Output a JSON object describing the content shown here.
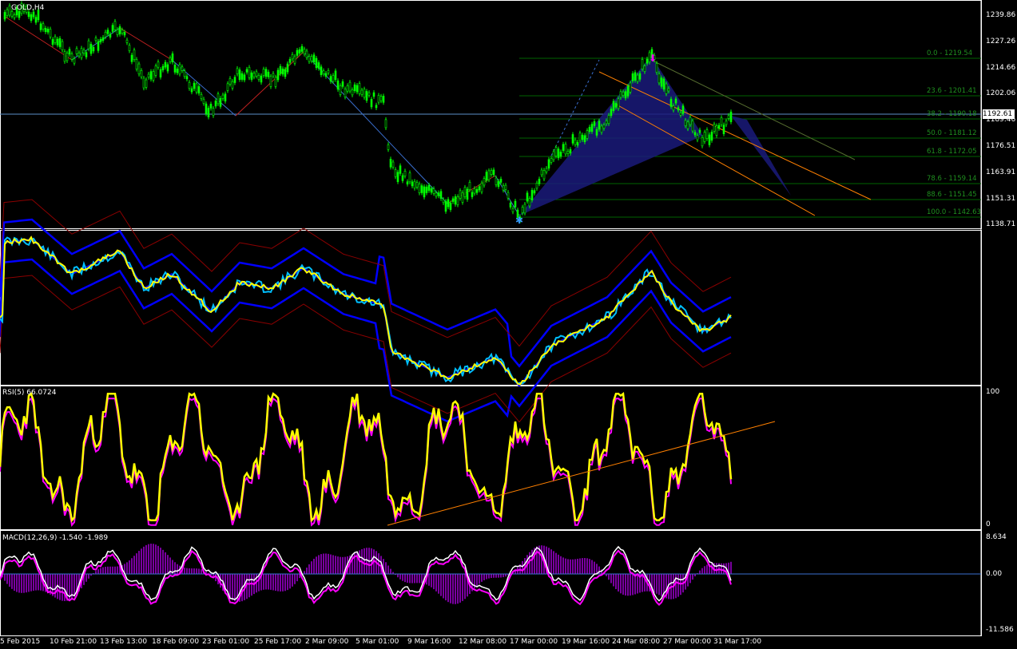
{
  "chart_title": "GOLD,H4",
  "colors": {
    "bg": "#000000",
    "grid": "#ffffff",
    "bull": "#00ff00",
    "bear": "#00cc00",
    "fib": "#006400",
    "pattern": "#1a1a7a",
    "band": "#0000ff",
    "ema": "#ffff00",
    "rsi": "#ffff00",
    "signal": "#ff00ff",
    "trend": "#ff8000",
    "histogram": "#7a00a0"
  },
  "price_axis": [
    "1239.86",
    "1227.26",
    "1214.66",
    "1202.06",
    "1189.46",
    "1176.51",
    "1163.91",
    "1151.31",
    "1138.71"
  ],
  "current_price": "1192.61",
  "fib_levels": [
    {
      "label": "0.0 - 1219.54"
    },
    {
      "label": "23.6 - 1201.41"
    },
    {
      "label": "38.2 - 1190.18"
    },
    {
      "label": "50.0 - 1181.12"
    },
    {
      "label": "61.8 - 1172.05"
    },
    {
      "label": "78.6 - 1159.14"
    },
    {
      "label": "88.6 - 1151.45"
    },
    {
      "label": "100.0 - 1142.63"
    }
  ],
  "indicator_labels": {
    "rsi": "RSI(5) 66.0724",
    "rsi_max": "100",
    "rsi_min": "0",
    "macd": "MACD(12,26,9) -1.540 -1.989",
    "macd_max": "8.634",
    "macd_zero": "0.00",
    "macd_min": "-11.586"
  },
  "time_axis": [
    "5 Feb 2015",
    "10 Feb 21:00",
    "13 Feb 13:00",
    "18 Feb 09:00",
    "23 Feb 01:00",
    "25 Feb 17:00",
    "2 Mar 09:00",
    "5 Mar 01:00",
    "9 Mar 16:00",
    "12 Mar 08:00",
    "17 Mar 00:00",
    "19 Mar 16:00",
    "24 Mar 08:00",
    "27 Mar 00:00",
    "31 Mar 17:00"
  ]
}
